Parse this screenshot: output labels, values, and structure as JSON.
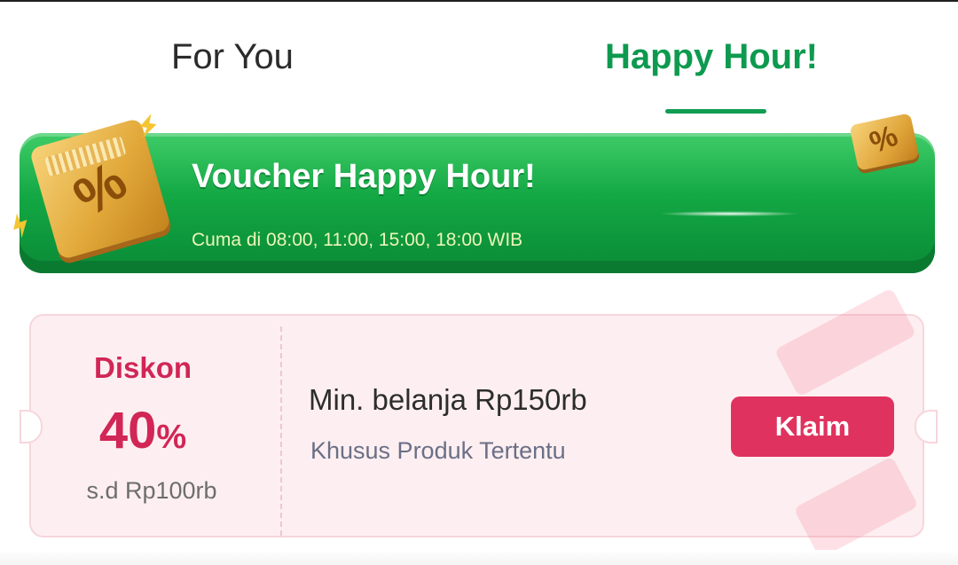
{
  "tabs": [
    {
      "label": "For You",
      "active": false
    },
    {
      "label": "Happy Hour!",
      "active": true
    }
  ],
  "banner": {
    "title": "Voucher Happy Hour!",
    "subtitle": "Cuma di 08:00, 11:00, 15:00, 18:00 WIB",
    "icon_glyph": "%"
  },
  "voucher": {
    "label": "Diskon",
    "amount": "40",
    "unit": "%",
    "cap": "s.d Rp100rb",
    "min_purchase": "Min. belanja Rp150rb",
    "scope": "Khusus Produk Tertentu",
    "button": "Klaim"
  },
  "colors": {
    "active_tab": "#0d9a4f",
    "banner_green": "#13a844",
    "accent_pink": "#d12656",
    "button_bg": "#e0325e",
    "voucher_bg": "#fdeff1"
  },
  "icons": [
    "percent-tag-icon",
    "lightning-icon",
    "ticket-decoration-icon"
  ]
}
